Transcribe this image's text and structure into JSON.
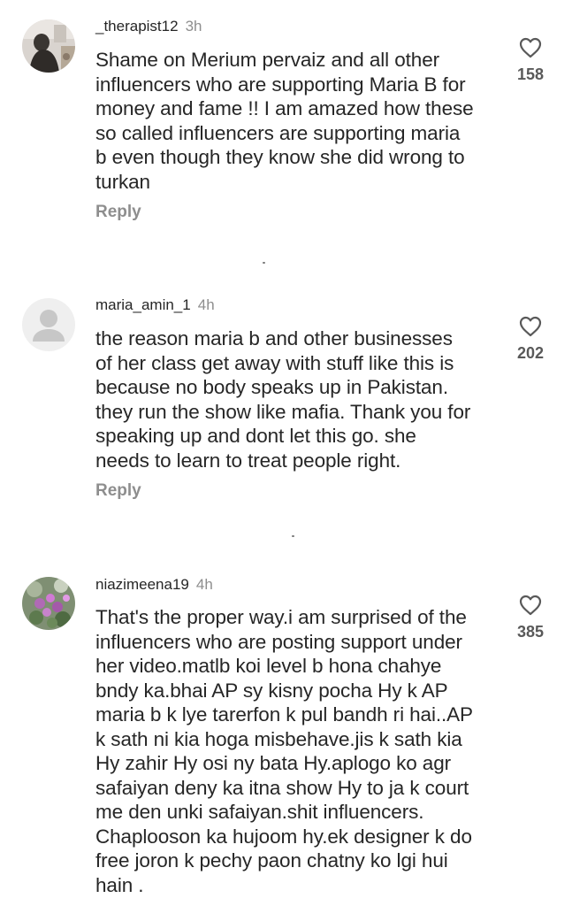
{
  "comments": [
    {
      "username": "_therapist12",
      "time": "3h",
      "text": "Shame on Merium pervaiz and all other\ninfluencers who are supporting Maria B for\nmoney and fame !! I am amazed how these\nso called influencers are supporting maria\nb even though they know she did wrong to\nturkan",
      "likes": "158",
      "reply_label": "Reply",
      "avatar": "photo-avatar"
    },
    {
      "username": "maria_amin_1",
      "time": "4h",
      "text": "the reason maria b and other businesses\nof her class get away with stuff like this is\nbecause no body speaks up in Pakistan.\nthey run the show like mafia. Thank you for\nspeaking up and dont let this go. she\nneeds to learn to treat people right.",
      "likes": "202",
      "reply_label": "Reply",
      "avatar": "default-avatar"
    },
    {
      "username": "niazimeena19",
      "time": "4h",
      "text": "That's the proper way.i am surprised of the\ninfluencers who are posting support under\nher video.matlb koi level b hona chahye\nbndy ka.bhai AP sy kisny pocha Hy k AP\nmaria b k lye tarerfon k pul bandh ri hai..AP\nk sath ni kia hoga misbehave.jis k sath kia\nHy zahir Hy osi ny bata Hy.aplogo ko agr\nsafaiyan deny ka itna show Hy to ja k court\nme den unki safaiyan.shit influencers.\nChaplooson ka hujoom hy.ek designer k do\nfree joron k pechy paon chatny ko lgi hui\nhain .",
      "likes": "385",
      "avatar": "flower-photo-avatar"
    }
  ],
  "icons": {
    "like": "heart-outline-icon"
  },
  "colors": {
    "text": "#262626",
    "muted": "#8e8e8e",
    "count": "#595959",
    "background": "#ffffff"
  }
}
